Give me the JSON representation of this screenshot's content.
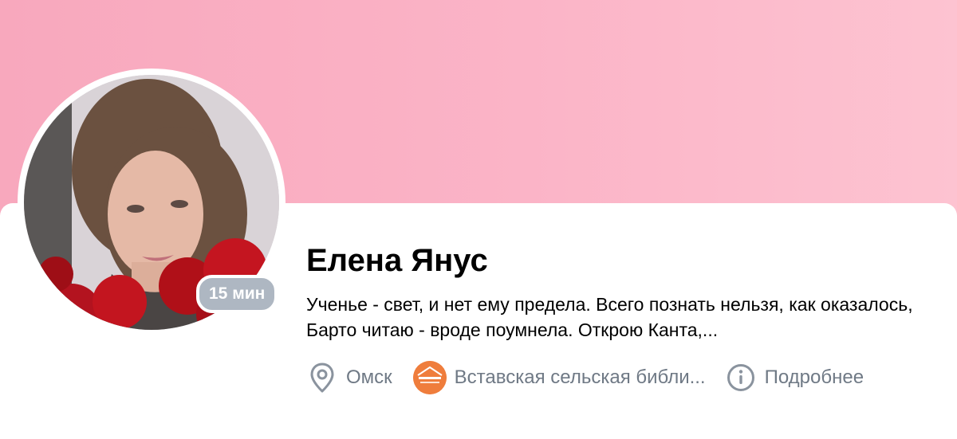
{
  "profile": {
    "name": "Елена Янус",
    "online_badge": "15 мин",
    "status_text": "Ученье - свет, и нет ему предела. Всего познать нельзя, как оказалось, Барто читаю - вроде поумнела. Открою Канта,..."
  },
  "info": {
    "location": {
      "label": "Омск",
      "icon": "location-pin-icon"
    },
    "workplace": {
      "label": "Вставская сельская библи...",
      "icon": "org-logo"
    },
    "details": {
      "label": "Подробнее",
      "icon": "info-icon"
    }
  },
  "colors": {
    "cover_gradient_start": "#f8a8bd",
    "cover_gradient_end": "#fdc3d1",
    "badge": "#aeb7c2",
    "secondary_text": "#6f7985",
    "org_logo": "#ef7d3c"
  }
}
